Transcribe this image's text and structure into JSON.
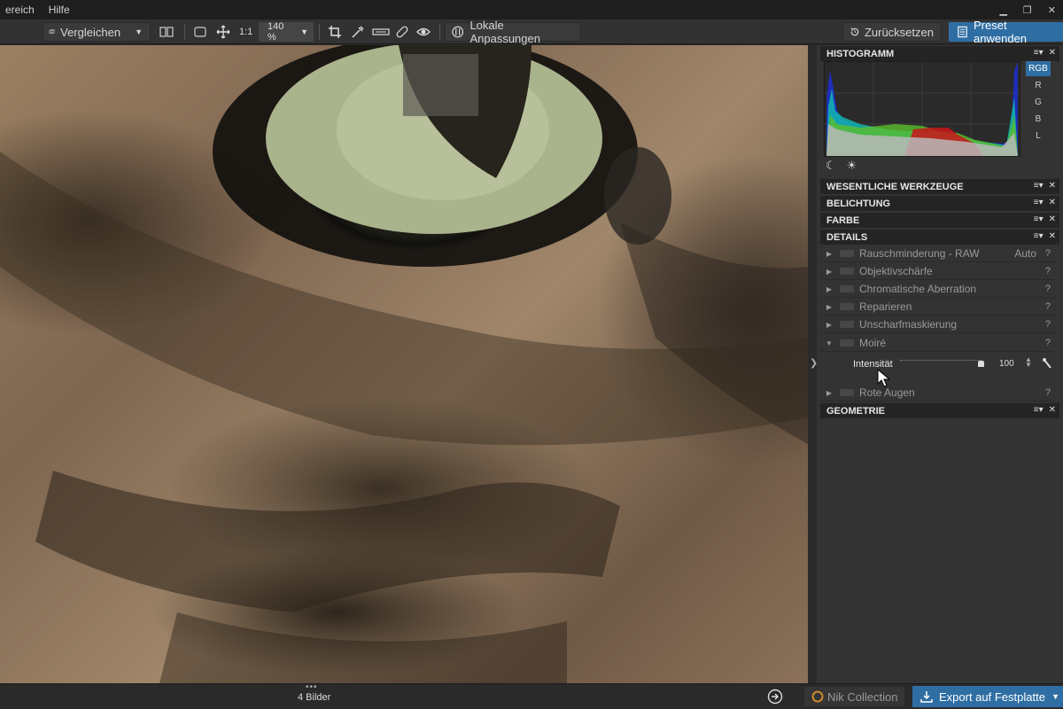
{
  "menubar": {
    "items": [
      "ereich",
      "Hilfe"
    ],
    "minimize": "▁",
    "restore": "❐",
    "close": "✕"
  },
  "toolbar": {
    "compare_label": "Vergleichen",
    "one_to_one": "1:1",
    "zoom_value": "140 %",
    "local_adjust_label": "Lokale Anpassungen",
    "reset_label": "Zurücksetzen",
    "preset_label": "Preset anwenden"
  },
  "panel": {
    "histogram": {
      "title": "HISTOGRAMM",
      "channels": [
        "RGB",
        "R",
        "G",
        "B",
        "L"
      ],
      "active_channel": "RGB"
    },
    "sections": {
      "essential": "WESENTLICHE WERKZEUGE",
      "exposure": "BELICHTUNG",
      "color": "FARBE",
      "details": "DETAILS",
      "geometry": "GEOMETRIE"
    },
    "header_ctrls": {
      "menu": "≡▾",
      "close": "✕"
    },
    "tools": [
      {
        "label": "Rauschminderung - RAW",
        "extra": "Auto",
        "help": "?"
      },
      {
        "label": "Objektivschärfe",
        "help": "?"
      },
      {
        "label": "Chromatische Aberration",
        "help": "?"
      },
      {
        "label": "Reparieren",
        "help": "?"
      },
      {
        "label": "Unscharfmaskierung",
        "help": "?"
      },
      {
        "label": "Moiré",
        "help": "?"
      },
      {
        "label": "Rote Augen",
        "help": "?"
      }
    ],
    "moire_slider": {
      "label": "Intensität",
      "value": "100"
    }
  },
  "statusbar": {
    "image_count": "4 Bilder",
    "dots": "•••",
    "nik_label": "Nik Collection",
    "export_label": "Export auf Festplatte"
  }
}
